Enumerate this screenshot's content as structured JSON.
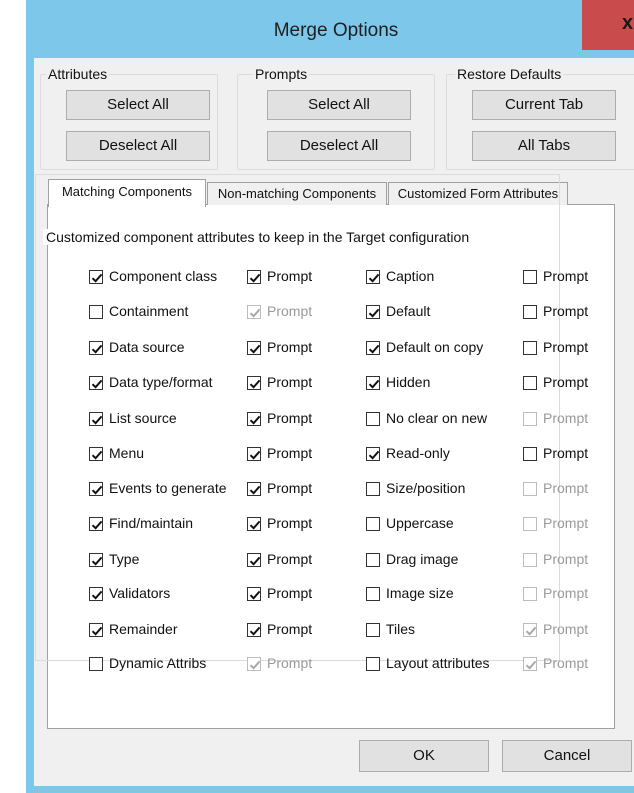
{
  "window": {
    "title": "Merge Options",
    "close_glyph": "x"
  },
  "groups": {
    "attributes": {
      "label": "Attributes",
      "select_all": "Select All",
      "deselect_all": "Deselect All"
    },
    "prompts": {
      "label": "Prompts",
      "select_all": "Select All",
      "deselect_all": "Deselect All"
    },
    "restore": {
      "label": "Restore Defaults",
      "current_tab": "Current Tab",
      "all_tabs": "All Tabs"
    }
  },
  "tabs": [
    {
      "label": "Matching Components",
      "active": true
    },
    {
      "label": "Non-matching Components",
      "active": false
    },
    {
      "label": "Customized Form Attributes",
      "active": false
    }
  ],
  "panel": {
    "group_label": "Customized component attributes to keep in the Target configuration",
    "columns": [
      {
        "rows": [
          {
            "label": "Component class",
            "checked": true,
            "disabled": false
          },
          {
            "label": "Containment",
            "checked": false,
            "disabled": false
          },
          {
            "label": "Data source",
            "checked": true,
            "disabled": false
          },
          {
            "label": "Data type/format",
            "checked": true,
            "disabled": false
          },
          {
            "label": "List source",
            "checked": true,
            "disabled": false
          },
          {
            "label": "Menu",
            "checked": true,
            "disabled": false
          },
          {
            "label": "Events to generate",
            "checked": true,
            "disabled": false
          },
          {
            "label": "Find/maintain",
            "checked": true,
            "disabled": false
          },
          {
            "label": "Type",
            "checked": true,
            "disabled": false
          },
          {
            "label": "Validators",
            "checked": true,
            "disabled": false
          },
          {
            "label": "Remainder",
            "checked": true,
            "disabled": false
          },
          {
            "label": "Dynamic Attribs",
            "checked": false,
            "disabled": false
          }
        ]
      },
      {
        "rows": [
          {
            "label": "Prompt",
            "checked": true,
            "disabled": false
          },
          {
            "label": "Prompt",
            "checked": true,
            "disabled": true
          },
          {
            "label": "Prompt",
            "checked": true,
            "disabled": false
          },
          {
            "label": "Prompt",
            "checked": true,
            "disabled": false
          },
          {
            "label": "Prompt",
            "checked": true,
            "disabled": false
          },
          {
            "label": "Prompt",
            "checked": true,
            "disabled": false
          },
          {
            "label": "Prompt",
            "checked": true,
            "disabled": false
          },
          {
            "label": "Prompt",
            "checked": true,
            "disabled": false
          },
          {
            "label": "Prompt",
            "checked": true,
            "disabled": false
          },
          {
            "label": "Prompt",
            "checked": true,
            "disabled": false
          },
          {
            "label": "Prompt",
            "checked": true,
            "disabled": false
          },
          {
            "label": "Prompt",
            "checked": true,
            "disabled": true
          }
        ]
      },
      {
        "rows": [
          {
            "label": "Caption",
            "checked": true,
            "disabled": false
          },
          {
            "label": "Default",
            "checked": true,
            "disabled": false
          },
          {
            "label": "Default on copy",
            "checked": true,
            "disabled": false
          },
          {
            "label": "Hidden",
            "checked": true,
            "disabled": false
          },
          {
            "label": "No clear on new",
            "checked": false,
            "disabled": false
          },
          {
            "label": "Read-only",
            "checked": true,
            "disabled": false
          },
          {
            "label": "Size/position",
            "checked": false,
            "disabled": false
          },
          {
            "label": "Uppercase",
            "checked": false,
            "disabled": false
          },
          {
            "label": "Drag image",
            "checked": false,
            "disabled": false
          },
          {
            "label": "Image size",
            "checked": false,
            "disabled": false
          },
          {
            "label": "Tiles",
            "checked": false,
            "disabled": false
          },
          {
            "label": "Layout attributes",
            "checked": false,
            "disabled": false
          }
        ]
      },
      {
        "rows": [
          {
            "label": "Prompt",
            "checked": false,
            "disabled": false
          },
          {
            "label": "Prompt",
            "checked": false,
            "disabled": false
          },
          {
            "label": "Prompt",
            "checked": false,
            "disabled": false
          },
          {
            "label": "Prompt",
            "checked": false,
            "disabled": false
          },
          {
            "label": "Prompt",
            "checked": false,
            "disabled": true
          },
          {
            "label": "Prompt",
            "checked": false,
            "disabled": false
          },
          {
            "label": "Prompt",
            "checked": false,
            "disabled": true
          },
          {
            "label": "Prompt",
            "checked": false,
            "disabled": true
          },
          {
            "label": "Prompt",
            "checked": false,
            "disabled": true
          },
          {
            "label": "Prompt",
            "checked": false,
            "disabled": true
          },
          {
            "label": "Prompt",
            "checked": true,
            "disabled": true
          },
          {
            "label": "Prompt",
            "checked": true,
            "disabled": true
          }
        ]
      }
    ]
  },
  "footer": {
    "ok": "OK",
    "cancel": "Cancel"
  }
}
